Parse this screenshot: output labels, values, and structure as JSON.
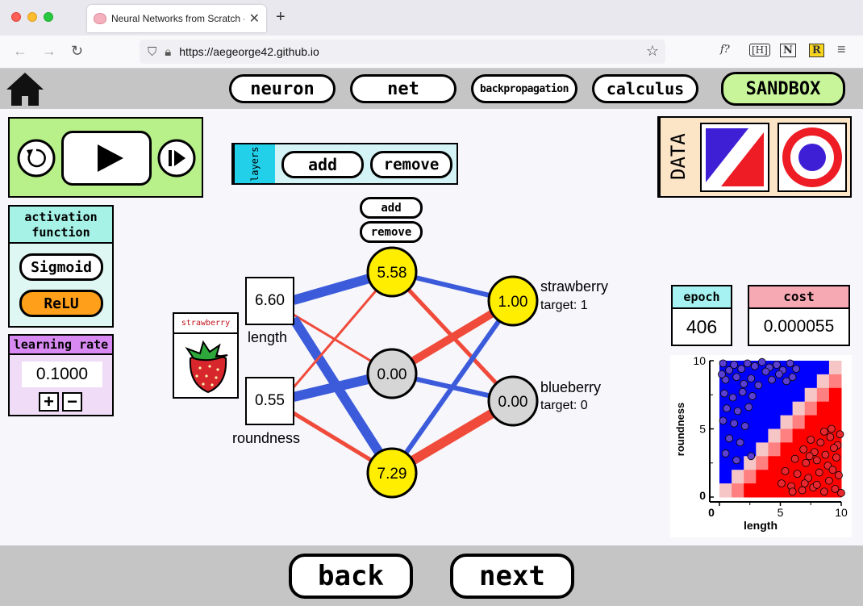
{
  "browser": {
    "tab_title": "Neural Networks from Scratch -",
    "url": "https://aegeorge42.github.io",
    "ext_fx": "f?",
    "ext_hl": "[H]",
    "ext_n": "N",
    "ext_r": "R"
  },
  "nav": {
    "tabs": [
      "neuron",
      "net",
      "backpropagation",
      "calculus",
      "SANDBOX"
    ],
    "back": "back",
    "next": "next"
  },
  "layers": {
    "label": "layers",
    "add": "add",
    "remove": "remove"
  },
  "neuron_controls": {
    "add": "add",
    "remove": "remove"
  },
  "data_panel": {
    "label": "DATA"
  },
  "activation": {
    "title": "activation function",
    "options": [
      "Sigmoid",
      "ReLU"
    ],
    "selected": "ReLU"
  },
  "learning_rate": {
    "title": "learning rate",
    "value": "0.1000",
    "plus": "+",
    "minus": "−"
  },
  "sample": {
    "label": "strawberry"
  },
  "inputs": [
    {
      "value": "6.60",
      "label": "length"
    },
    {
      "value": "0.55",
      "label": "roundness"
    }
  ],
  "hidden": [
    "5.58",
    "0.00",
    "7.29"
  ],
  "outputs": [
    {
      "value": "1.00",
      "label": "strawberry",
      "target": "target: 1"
    },
    {
      "value": "0.00",
      "label": "blueberry",
      "target": "target: 0"
    }
  ],
  "epoch": {
    "label": "epoch",
    "value": "406"
  },
  "cost": {
    "label": "cost",
    "value": "0.000055"
  },
  "colors": {
    "positive_weight": "#3b5bdb",
    "negative_weight": "#f04a3a",
    "active_neuron": "#ffee00",
    "inactive_neuron": "#d6d6d6",
    "sandbox": "#c8f59a"
  },
  "chart_data": {
    "type": "scatter",
    "xlabel": "length",
    "ylabel": "roundness",
    "xlim": [
      0,
      10
    ],
    "ylim": [
      0,
      10
    ],
    "x_ticks": [
      "0",
      "5",
      "10"
    ],
    "y_ticks": [
      "0",
      "5",
      "10"
    ],
    "series": [
      {
        "color": "#5b3fd0",
        "points": [
          [
            0.3,
            9.8
          ],
          [
            0.8,
            9.3
          ],
          [
            1.2,
            9.7
          ],
          [
            1.8,
            9.4
          ],
          [
            2.3,
            9.8
          ],
          [
            2.9,
            9.6
          ],
          [
            3.5,
            9.9
          ],
          [
            4.1,
            9.5
          ],
          [
            4.7,
            9.7
          ],
          [
            5.2,
            9.3
          ],
          [
            5.8,
            9.8
          ],
          [
            6.3,
            9.4
          ],
          [
            0.5,
            8.6
          ],
          [
            1.4,
            8.8
          ],
          [
            2.0,
            8.3
          ],
          [
            2.6,
            8.7
          ],
          [
            3.2,
            8.2
          ],
          [
            4.3,
            8.6
          ],
          [
            5.5,
            8.5
          ],
          [
            0.4,
            7.6
          ],
          [
            1.1,
            7.3
          ],
          [
            1.9,
            7.7
          ],
          [
            2.7,
            7.4
          ],
          [
            0.6,
            6.5
          ],
          [
            1.5,
            6.3
          ],
          [
            2.4,
            6.6
          ],
          [
            0.3,
            5.6
          ],
          [
            1.2,
            5.4
          ],
          [
            2.1,
            5.2
          ],
          [
            0.8,
            4.3
          ],
          [
            1.7,
            4.0
          ],
          [
            0.5,
            3.2
          ],
          [
            1.4,
            2.7
          ],
          [
            2.6,
            3.0
          ],
          [
            0.2,
            9.0
          ],
          [
            3.8,
            9.2
          ],
          [
            4.9,
            9.0
          ],
          [
            6.0,
            8.8
          ]
        ]
      },
      {
        "color": "#e8262d",
        "points": [
          [
            7.5,
            4.2
          ],
          [
            8.3,
            4.0
          ],
          [
            9.1,
            4.4
          ],
          [
            9.7,
            3.8
          ],
          [
            6.9,
            3.5
          ],
          [
            7.8,
            3.3
          ],
          [
            8.7,
            3.1
          ],
          [
            9.4,
            3.6
          ],
          [
            6.2,
            2.8
          ],
          [
            7.1,
            2.5
          ],
          [
            8.0,
            2.7
          ],
          [
            8.9,
            2.3
          ],
          [
            9.6,
            2.9
          ],
          [
            5.4,
            1.9
          ],
          [
            6.4,
            1.7
          ],
          [
            7.3,
            1.4
          ],
          [
            8.2,
            1.8
          ],
          [
            9.0,
            1.2
          ],
          [
            9.8,
            1.6
          ],
          [
            5.1,
            1.0
          ],
          [
            5.9,
            0.8
          ],
          [
            6.8,
            0.5
          ],
          [
            7.7,
            0.7
          ],
          [
            8.6,
            0.4
          ],
          [
            9.5,
            0.6
          ],
          [
            10.0,
            0.3
          ],
          [
            9.2,
            5.0
          ],
          [
            8.6,
            4.8
          ],
          [
            9.9,
            4.6
          ],
          [
            7.0,
            1.0
          ],
          [
            6.0,
            0.4
          ],
          [
            8.0,
            0.9
          ],
          [
            9.3,
            2.0
          ],
          [
            7.4,
            3.0
          ]
        ]
      }
    ]
  }
}
